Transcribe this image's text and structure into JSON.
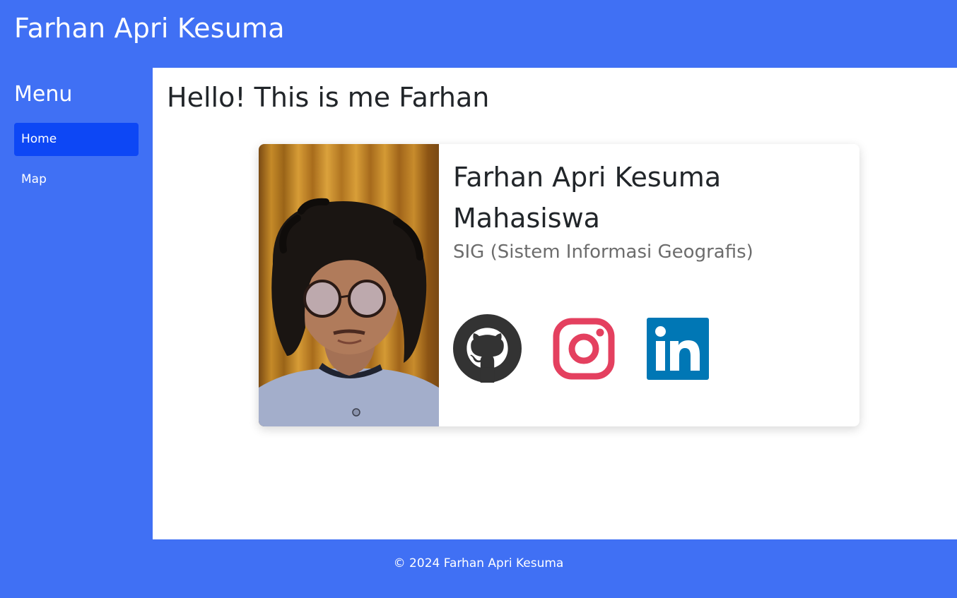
{
  "header": {
    "title": "Farhan Apri Kesuma"
  },
  "sidebar": {
    "menu_title": "Menu",
    "items": [
      {
        "label": "Home",
        "active": true
      },
      {
        "label": "Map",
        "active": false
      }
    ]
  },
  "main": {
    "heading": "Hello! This is me Farhan",
    "card": {
      "name": "Farhan Apri Kesuma",
      "role": "Mahasiswa",
      "subtitle": "SIG (Sistem Informasi Geografis)",
      "socials": [
        {
          "icon": "github-icon"
        },
        {
          "icon": "instagram-icon"
        },
        {
          "icon": "linkedin-icon"
        }
      ]
    }
  },
  "footer": {
    "text": "© 2024 Farhan Apri Kesuma"
  },
  "colors": {
    "brand": "#4070f4",
    "active_nav": "#0d47f5",
    "github": "#333333",
    "instagram": "#e4405f",
    "linkedin": "#0077b5"
  }
}
